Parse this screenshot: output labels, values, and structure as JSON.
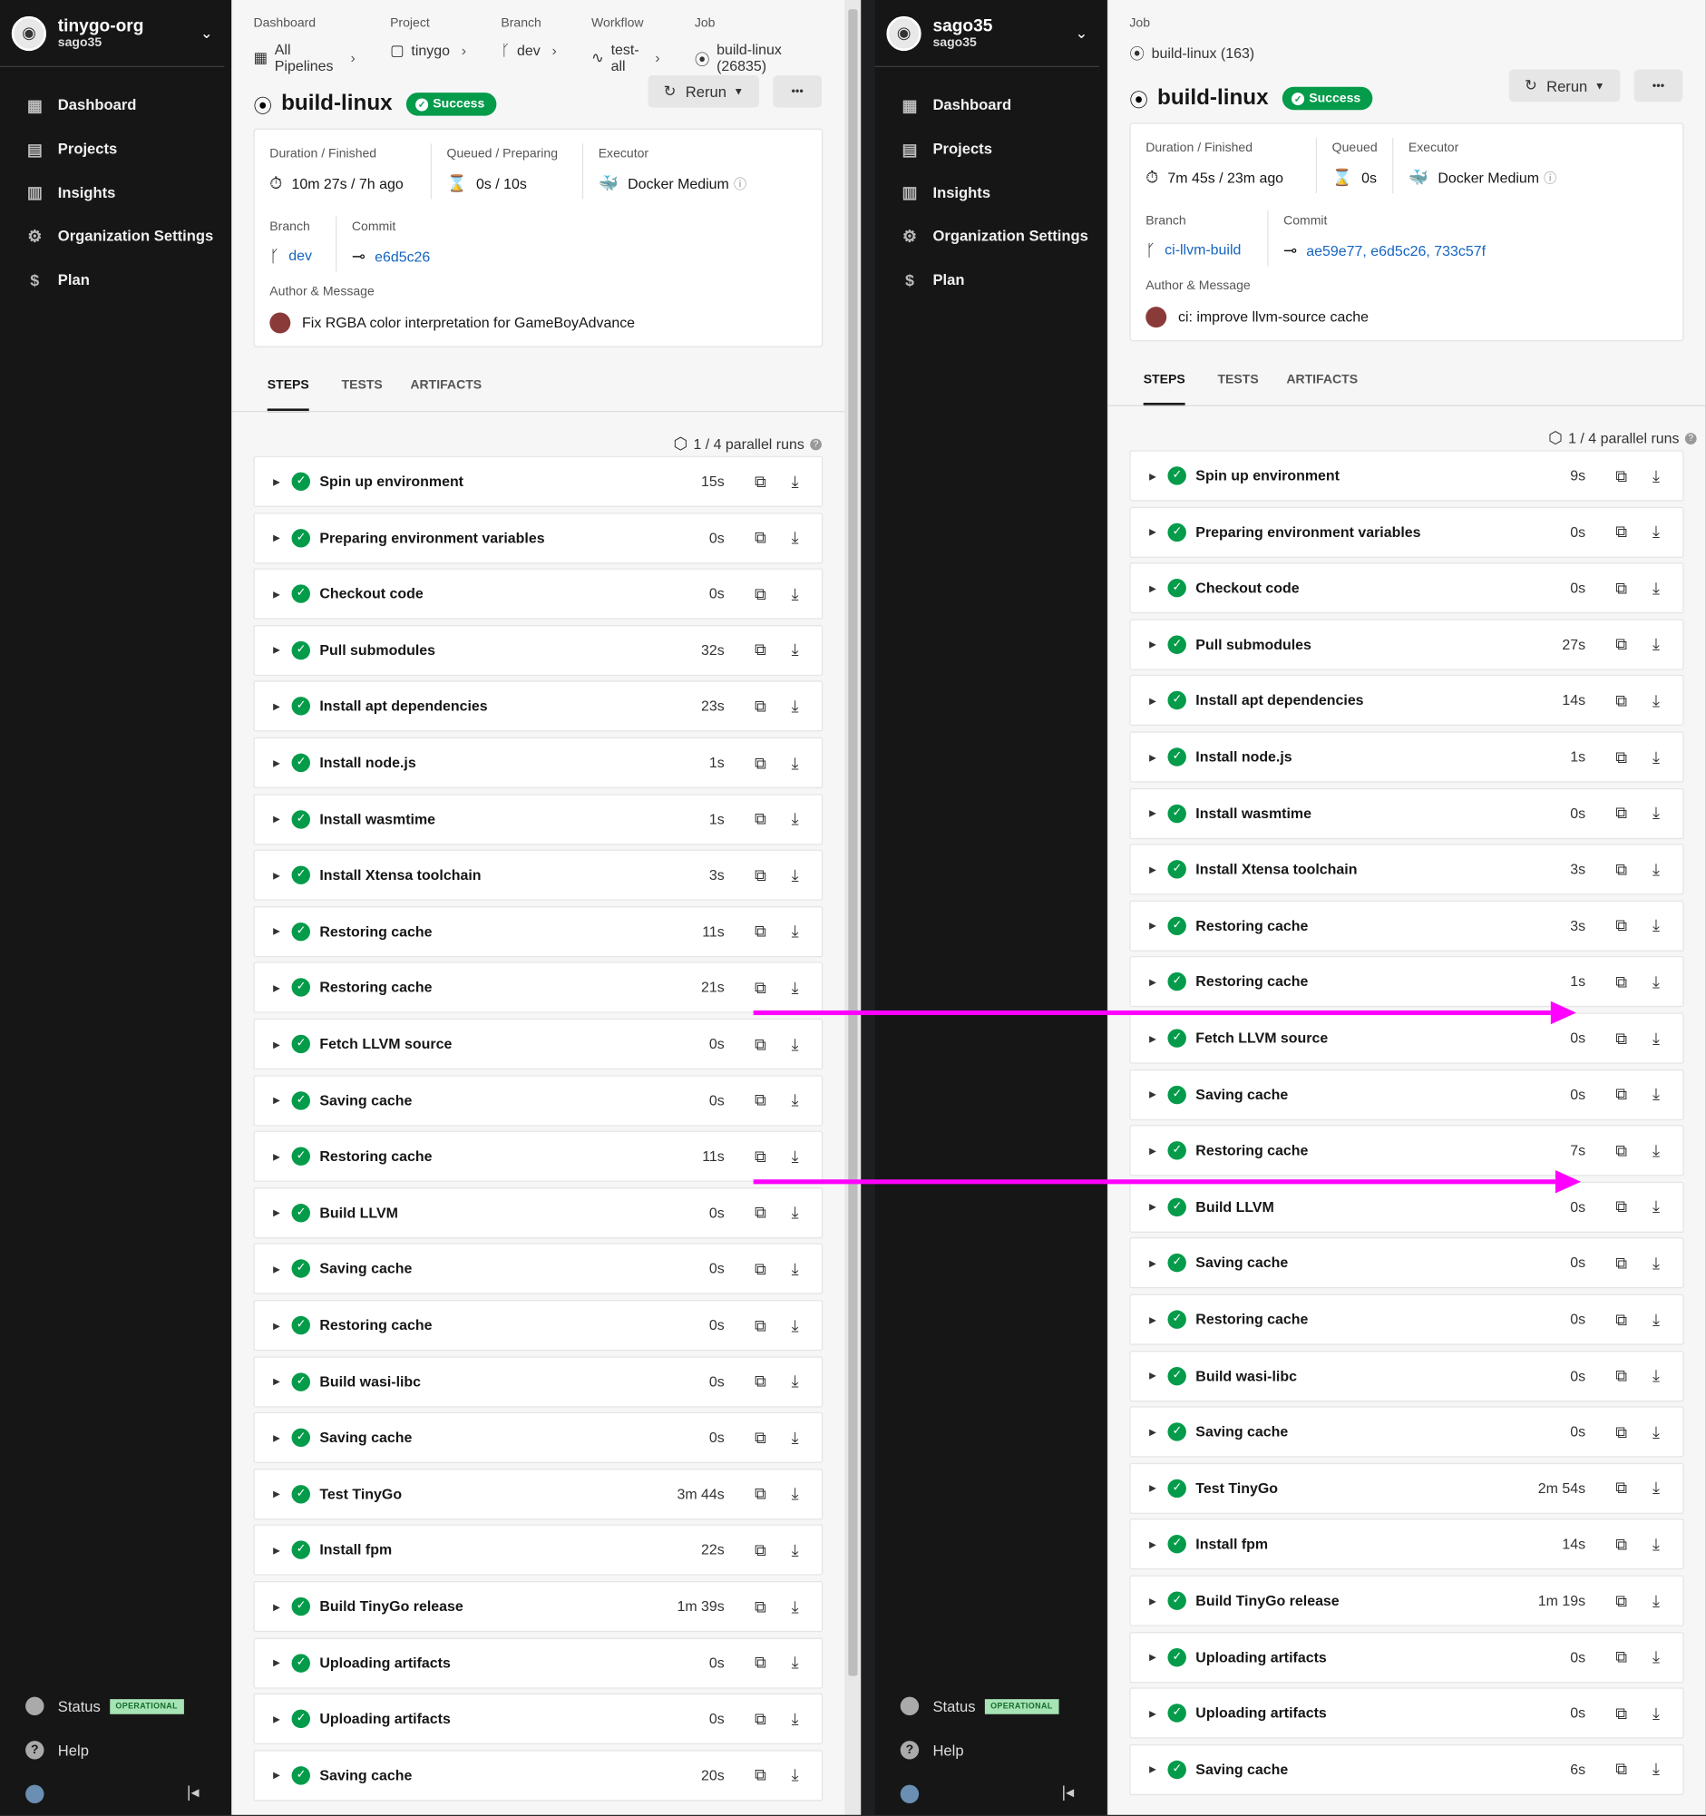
{
  "left": {
    "org": {
      "name": "tinygo-org",
      "user": "sago35",
      "avatar_icon": "org-logo-icon"
    },
    "nav": [
      {
        "label": "Dashboard",
        "icon": "dashboard-icon"
      },
      {
        "label": "Projects",
        "icon": "projects-icon"
      },
      {
        "label": "Insights",
        "icon": "insights-icon"
      },
      {
        "label": "Organization Settings",
        "icon": "gear-icon"
      },
      {
        "label": "Plan",
        "icon": "plan-icon"
      }
    ],
    "status_label": "Status",
    "status_badge": "OPERATIONAL",
    "help_label": "Help",
    "breadcrumb": [
      {
        "label": "Dashboard",
        "value": "All Pipelines"
      },
      {
        "label": "Project",
        "value": "tinygo"
      },
      {
        "label": "Branch",
        "value": "dev"
      },
      {
        "label": "Workflow",
        "value": "test-all"
      },
      {
        "label": "Job",
        "value": "build-linux (26835)"
      }
    ],
    "title": "build-linux",
    "status": "Success",
    "rerun": "Rerun",
    "more": "•••",
    "meta": {
      "duration_label": "Duration / Finished",
      "duration": "10m 27s / 7h ago",
      "queued_label": "Queued / Preparing",
      "queued": "0s / 10s",
      "executor_label": "Executor",
      "executor": "Docker Medium",
      "branch_label": "Branch",
      "branch": "dev",
      "commit_label": "Commit",
      "commit": "e6d5c26",
      "author_label": "Author & Message",
      "message": "Fix RGBA color interpretation for GameBoyAdvance"
    },
    "tabs": [
      "STEPS",
      "TESTS",
      "ARTIFACTS"
    ],
    "runs": "1 / 4 parallel runs",
    "steps": [
      [
        "Spin up environment",
        "15s"
      ],
      [
        "Preparing environment variables",
        "0s"
      ],
      [
        "Checkout code",
        "0s"
      ],
      [
        "Pull submodules",
        "32s"
      ],
      [
        "Install apt dependencies",
        "23s"
      ],
      [
        "Install node.js",
        "1s"
      ],
      [
        "Install wasmtime",
        "1s"
      ],
      [
        "Install Xtensa toolchain",
        "3s"
      ],
      [
        "Restoring cache",
        "11s"
      ],
      [
        "Restoring cache",
        "21s"
      ],
      [
        "Fetch LLVM source",
        "0s"
      ],
      [
        "Saving cache",
        "0s"
      ],
      [
        "Restoring cache",
        "11s"
      ],
      [
        "Build LLVM",
        "0s"
      ],
      [
        "Saving cache",
        "0s"
      ],
      [
        "Restoring cache",
        "0s"
      ],
      [
        "Build wasi-libc",
        "0s"
      ],
      [
        "Saving cache",
        "0s"
      ],
      [
        "Test TinyGo",
        "3m 44s"
      ],
      [
        "Install fpm",
        "22s"
      ],
      [
        "Build TinyGo release",
        "1m 39s"
      ],
      [
        "Uploading artifacts",
        "0s"
      ],
      [
        "Uploading artifacts",
        "0s"
      ],
      [
        "Saving cache",
        "20s"
      ]
    ]
  },
  "right": {
    "org": {
      "name": "sago35",
      "user": "sago35",
      "avatar_icon": "user-avatar-icon"
    },
    "nav": [
      {
        "label": "Dashboard",
        "icon": "dashboard-icon"
      },
      {
        "label": "Projects",
        "icon": "projects-icon"
      },
      {
        "label": "Insights",
        "icon": "insights-icon"
      },
      {
        "label": "Organization Settings",
        "icon": "gear-icon"
      },
      {
        "label": "Plan",
        "icon": "plan-icon"
      }
    ],
    "status_label": "Status",
    "status_badge": "OPERATIONAL",
    "help_label": "Help",
    "breadcrumb": [
      {
        "label": "Job",
        "value": "build-linux (163)"
      }
    ],
    "title": "build-linux",
    "status": "Success",
    "rerun": "Rerun",
    "more": "•••",
    "meta": {
      "duration_label": "Duration / Finished",
      "duration": "7m 45s / 23m ago",
      "queued_label": "Queued",
      "queued": "0s",
      "executor_label": "Executor",
      "executor": "Docker Medium",
      "branch_label": "Branch",
      "branch": "ci-llvm-build",
      "commit_label": "Commit",
      "commit": "ae59e77, e6d5c26, 733c57f",
      "author_label": "Author & Message",
      "message": "ci: improve llvm-source cache"
    },
    "tabs": [
      "STEPS",
      "TESTS",
      "ARTIFACTS"
    ],
    "runs": "1 / 4 parallel runs",
    "steps": [
      [
        "Spin up environment",
        "9s"
      ],
      [
        "Preparing environment variables",
        "0s"
      ],
      [
        "Checkout code",
        "0s"
      ],
      [
        "Pull submodules",
        "27s"
      ],
      [
        "Install apt dependencies",
        "14s"
      ],
      [
        "Install node.js",
        "1s"
      ],
      [
        "Install wasmtime",
        "0s"
      ],
      [
        "Install Xtensa toolchain",
        "3s"
      ],
      [
        "Restoring cache",
        "3s"
      ],
      [
        "Restoring cache",
        "1s"
      ],
      [
        "Fetch LLVM source",
        "0s"
      ],
      [
        "Saving cache",
        "0s"
      ],
      [
        "Restoring cache",
        "7s"
      ],
      [
        "Build LLVM",
        "0s"
      ],
      [
        "Saving cache",
        "0s"
      ],
      [
        "Restoring cache",
        "0s"
      ],
      [
        "Build wasi-libc",
        "0s"
      ],
      [
        "Saving cache",
        "0s"
      ],
      [
        "Test TinyGo",
        "2m 54s"
      ],
      [
        "Install fpm",
        "14s"
      ],
      [
        "Build TinyGo release",
        "1m 19s"
      ],
      [
        "Uploading artifacts",
        "0s"
      ],
      [
        "Uploading artifacts",
        "0s"
      ],
      [
        "Saving cache",
        "6s"
      ]
    ]
  },
  "colors": {
    "success": "#049b4a",
    "sidebar": "#161616",
    "annotation_arrow": "#ff00ff",
    "link": "#1565c0"
  }
}
